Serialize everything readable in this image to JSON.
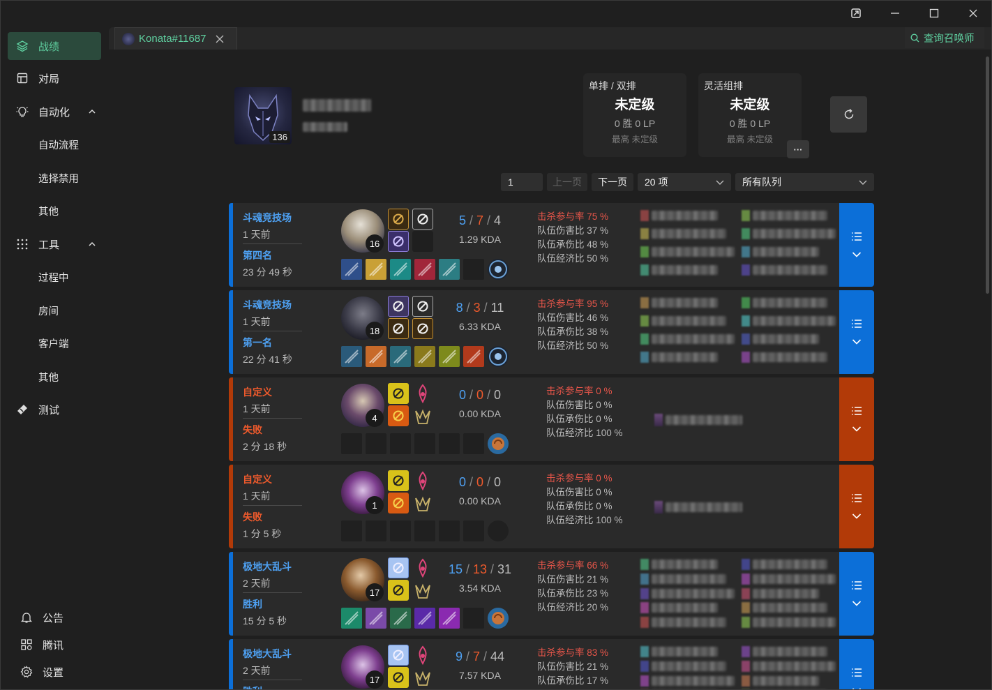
{
  "window": {
    "controls": [
      "pin-icon",
      "minimize-icon",
      "maximize-icon",
      "close-icon"
    ]
  },
  "sidebar": {
    "items": [
      {
        "label": "战绩",
        "icon": "layers-icon",
        "active": true
      },
      {
        "label": "对局",
        "icon": "layout-icon"
      },
      {
        "label": "自动化",
        "icon": "bulb-icon",
        "expanded": true,
        "children": [
          "自动流程",
          "选择禁用",
          "其他"
        ]
      },
      {
        "label": "工具",
        "icon": "grid-icon",
        "expanded": true,
        "children": [
          "过程中",
          "房间",
          "客户端",
          "其他"
        ]
      },
      {
        "label": "测试",
        "icon": "ticket-icon"
      }
    ],
    "bottom": [
      {
        "label": "公告",
        "icon": "bell-icon"
      },
      {
        "label": "腾讯",
        "icon": "apps-icon"
      },
      {
        "label": "设置",
        "icon": "gear-icon"
      }
    ]
  },
  "tab": {
    "label": "Konata#11687"
  },
  "search": {
    "label": "查询召唤师"
  },
  "summoner": {
    "level": "136"
  },
  "ranked": [
    {
      "queue": "单排 / 双排",
      "tier": "未定级",
      "record": "0 胜 0 LP",
      "peak": "最高 未定级"
    },
    {
      "queue": "灵活组排",
      "tier": "未定级",
      "record": "0 胜 0 LP",
      "peak": "最高 未定级"
    }
  ],
  "more_label": "···",
  "pager": {
    "page": "1",
    "prev": "上一页",
    "next": "下一页",
    "size": "20 项",
    "queue": "所有队列"
  },
  "colors": {
    "win": "#0c6fd8",
    "loss": "#b23a08",
    "mode_win": "#4ea1f3",
    "mode_loss": "#ee5a2c",
    "accent": "#5fd0a0"
  },
  "matches": [
    {
      "mode": "斗魂竞技场",
      "when": "1 天前",
      "result": "第四名",
      "duration": "23 分 49 秒",
      "outcome": "win",
      "level": "16",
      "k": "5",
      "d": "7",
      "a": "4",
      "kda": "1.29 KDA",
      "stats": [
        "击杀参与率 75 %",
        "队伍伤害比 37 %",
        "队伍承伤比 48 %",
        "队伍经济比 50 %"
      ],
      "players": 8
    },
    {
      "mode": "斗魂竞技场",
      "when": "1 天前",
      "result": "第一名",
      "duration": "22 分 41 秒",
      "outcome": "win",
      "level": "18",
      "k": "8",
      "d": "3",
      "a": "11",
      "kda": "6.33 KDA",
      "stats": [
        "击杀参与率 95 %",
        "队伍伤害比 46 %",
        "队伍承伤比 38 %",
        "队伍经济比 50 %"
      ],
      "players": 8
    },
    {
      "mode": "自定义",
      "when": "1 天前",
      "result": "失败",
      "duration": "2 分 18 秒",
      "outcome": "loss",
      "level": "4",
      "k": "0",
      "d": "0",
      "a": "0",
      "kda": "0.00 KDA",
      "stats": [
        "击杀参与率 0 %",
        "队伍伤害比 0 %",
        "队伍承伤比 0 %",
        "队伍经济比 100 %"
      ],
      "players": 1
    },
    {
      "mode": "自定义",
      "when": "1 天前",
      "result": "失败",
      "duration": "1 分 5 秒",
      "outcome": "loss",
      "level": "1",
      "k": "0",
      "d": "0",
      "a": "0",
      "kda": "0.00 KDA",
      "stats": [
        "击杀参与率 0 %",
        "队伍伤害比 0 %",
        "队伍承伤比 0 %",
        "队伍经济比 100 %"
      ],
      "players": 1
    },
    {
      "mode": "极地大乱斗",
      "when": "2 天前",
      "result": "胜利",
      "duration": "15 分 5 秒",
      "outcome": "win",
      "level": "17",
      "k": "15",
      "d": "13",
      "a": "31",
      "kda": "3.54 KDA",
      "stats": [
        "击杀参与率 66 %",
        "队伍伤害比 21 %",
        "队伍承伤比 23 %",
        "队伍经济比 20 %"
      ],
      "players": 10
    },
    {
      "mode": "极地大乱斗",
      "when": "2 天前",
      "result": "胜利",
      "duration": "",
      "outcome": "win",
      "level": "17",
      "k": "9",
      "d": "7",
      "a": "44",
      "kda": "7.57 KDA",
      "stats": [
        "击杀参与率 83 %",
        "队伍伤害比 21 %",
        "队伍承伤比 17 %",
        "队伍经济比"
      ],
      "players": 10
    }
  ]
}
